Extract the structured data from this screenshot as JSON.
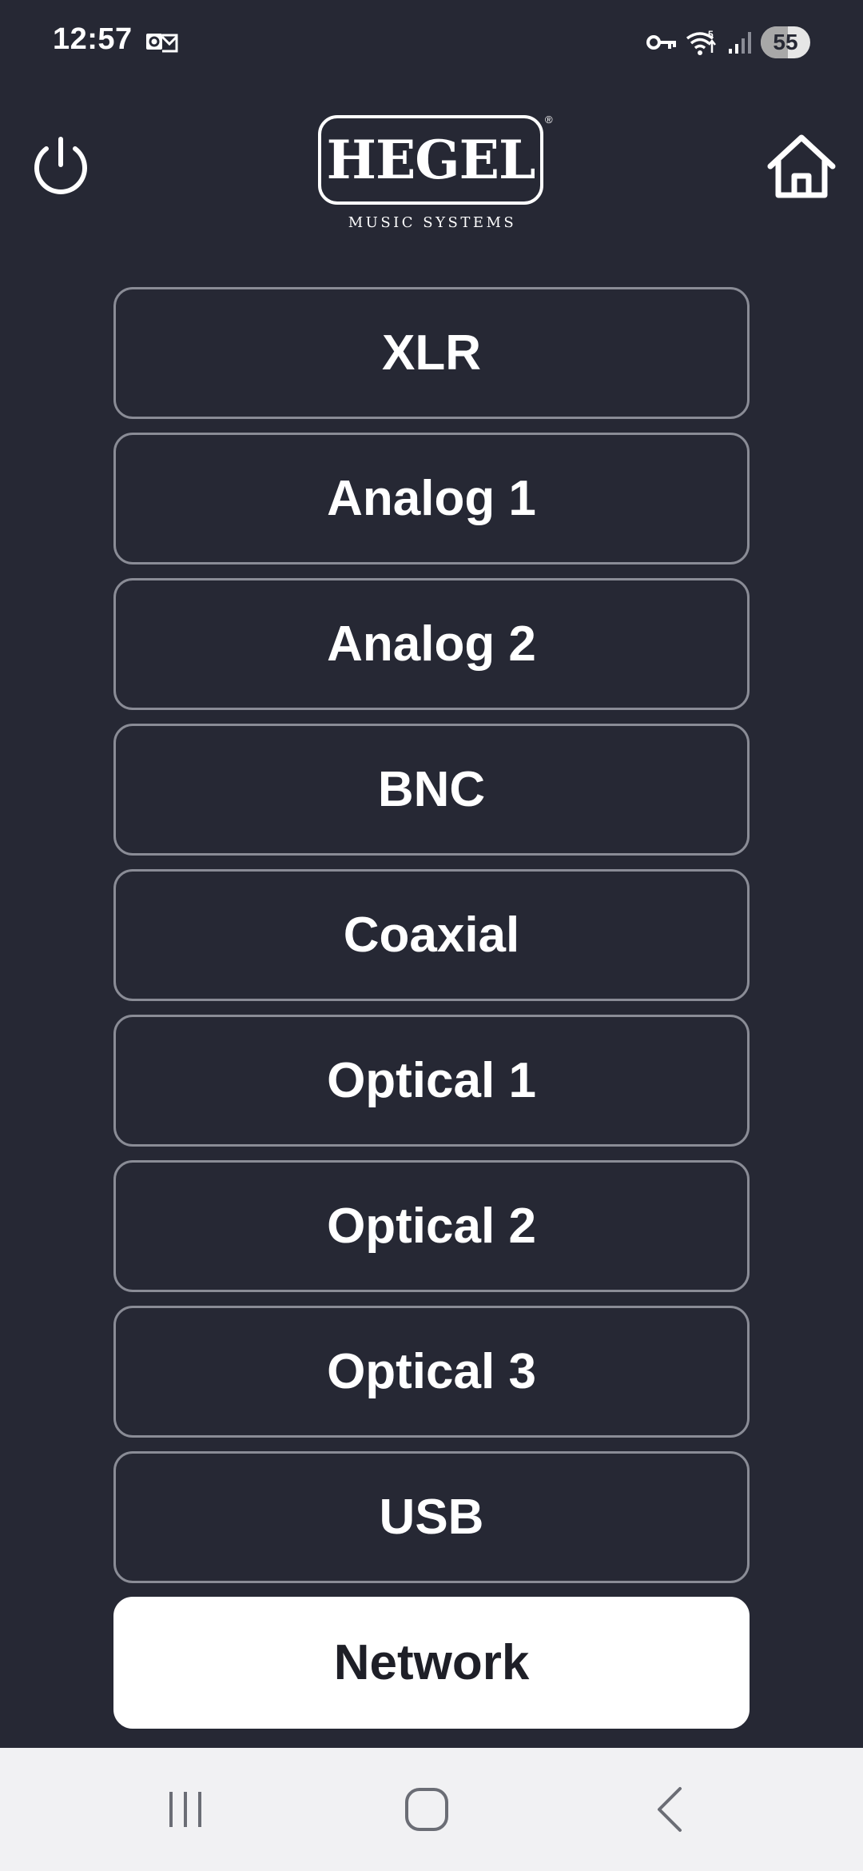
{
  "status_bar": {
    "time": "12:57",
    "battery_level": "55",
    "battery_fraction": 0.55,
    "left_icons": [
      "outlook-notification-icon"
    ],
    "right_icons": [
      "vpn-key-icon",
      "wifi-icon",
      "signal-icon",
      "battery-icon"
    ]
  },
  "header": {
    "logo_name": "HEGEL",
    "logo_registered": "®",
    "logo_tagline": "MUSIC SYSTEMS",
    "left_icon": "power-icon",
    "right_icon": "home-icon"
  },
  "sources": [
    {
      "label": "XLR",
      "active": false
    },
    {
      "label": "Analog 1",
      "active": false
    },
    {
      "label": "Analog 2",
      "active": false
    },
    {
      "label": "BNC",
      "active": false
    },
    {
      "label": "Coaxial",
      "active": false
    },
    {
      "label": "Optical 1",
      "active": false
    },
    {
      "label": "Optical 2",
      "active": false
    },
    {
      "label": "Optical 3",
      "active": false
    },
    {
      "label": "USB",
      "active": false
    },
    {
      "label": "Network",
      "active": true
    }
  ],
  "nav_bar": {
    "icons": [
      "recents-icon",
      "home-nav-icon",
      "back-icon"
    ]
  },
  "colors": {
    "background": "#262834",
    "button_border": "#8a8c96",
    "active_button_bg": "#ffffff",
    "active_button_text": "#1e1f27",
    "nav_bar_bg": "#f1f1f3"
  }
}
